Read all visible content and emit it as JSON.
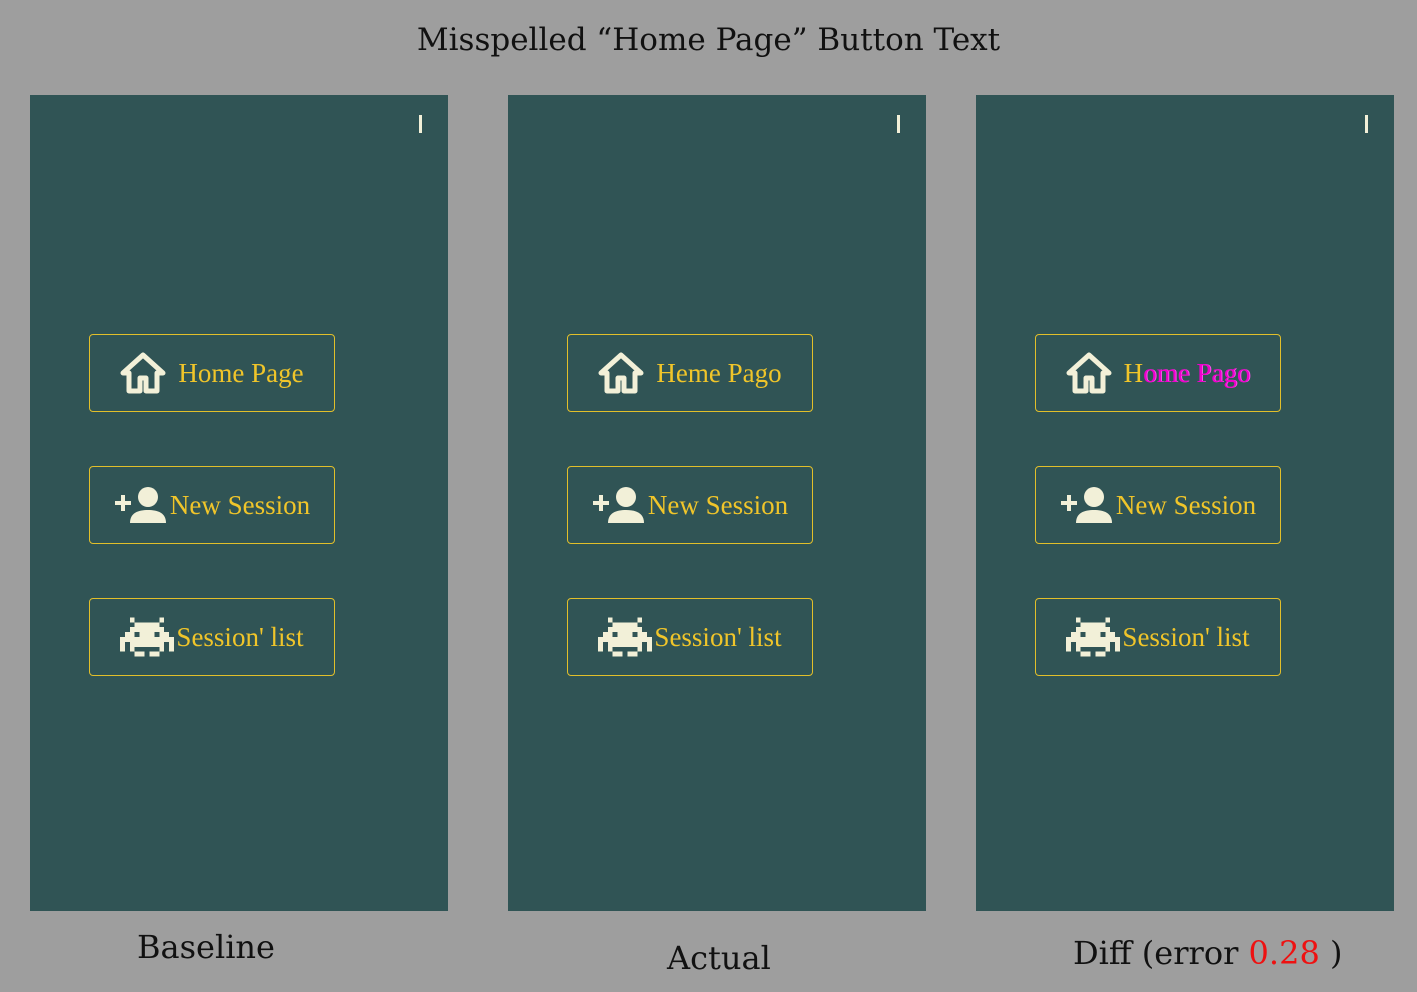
{
  "title": "Misspelled “Home Page” Button Text",
  "colors": {
    "page_background": "#9e9e9e",
    "panel_background": "#305455",
    "button_border": "#e2bf2a",
    "button_text": "#f0c52a",
    "icon": "#f2f0d8",
    "diff_highlight": "#ee00cc",
    "error_value": "#ee1111"
  },
  "panels": {
    "baseline": {
      "caption": "Baseline",
      "buttons": {
        "home": {
          "label": "Home Page",
          "icon": "home-icon"
        },
        "new_session": {
          "label": "New Session",
          "icon": "add-person-icon"
        },
        "session_list": {
          "label": "Session' list",
          "icon": "space-invader-icon"
        }
      }
    },
    "actual": {
      "caption": "Actual",
      "buttons": {
        "home": {
          "label": "Heme Pago",
          "icon": "home-icon"
        },
        "new_session": {
          "label": "New Session",
          "icon": "add-person-icon"
        },
        "session_list": {
          "label": "Session' list",
          "icon": "space-invader-icon"
        }
      }
    },
    "diff": {
      "caption_prefix": "Diff (error",
      "error_value": "0.28",
      "caption_suffix": ")",
      "buttons": {
        "home": {
          "label_unchanged": "H",
          "label_changed": "ome Pago",
          "icon": "home-icon"
        },
        "new_session": {
          "label": "New Session",
          "icon": "add-person-icon"
        },
        "session_list": {
          "label": "Session' list",
          "icon": "space-invader-icon"
        }
      }
    }
  }
}
